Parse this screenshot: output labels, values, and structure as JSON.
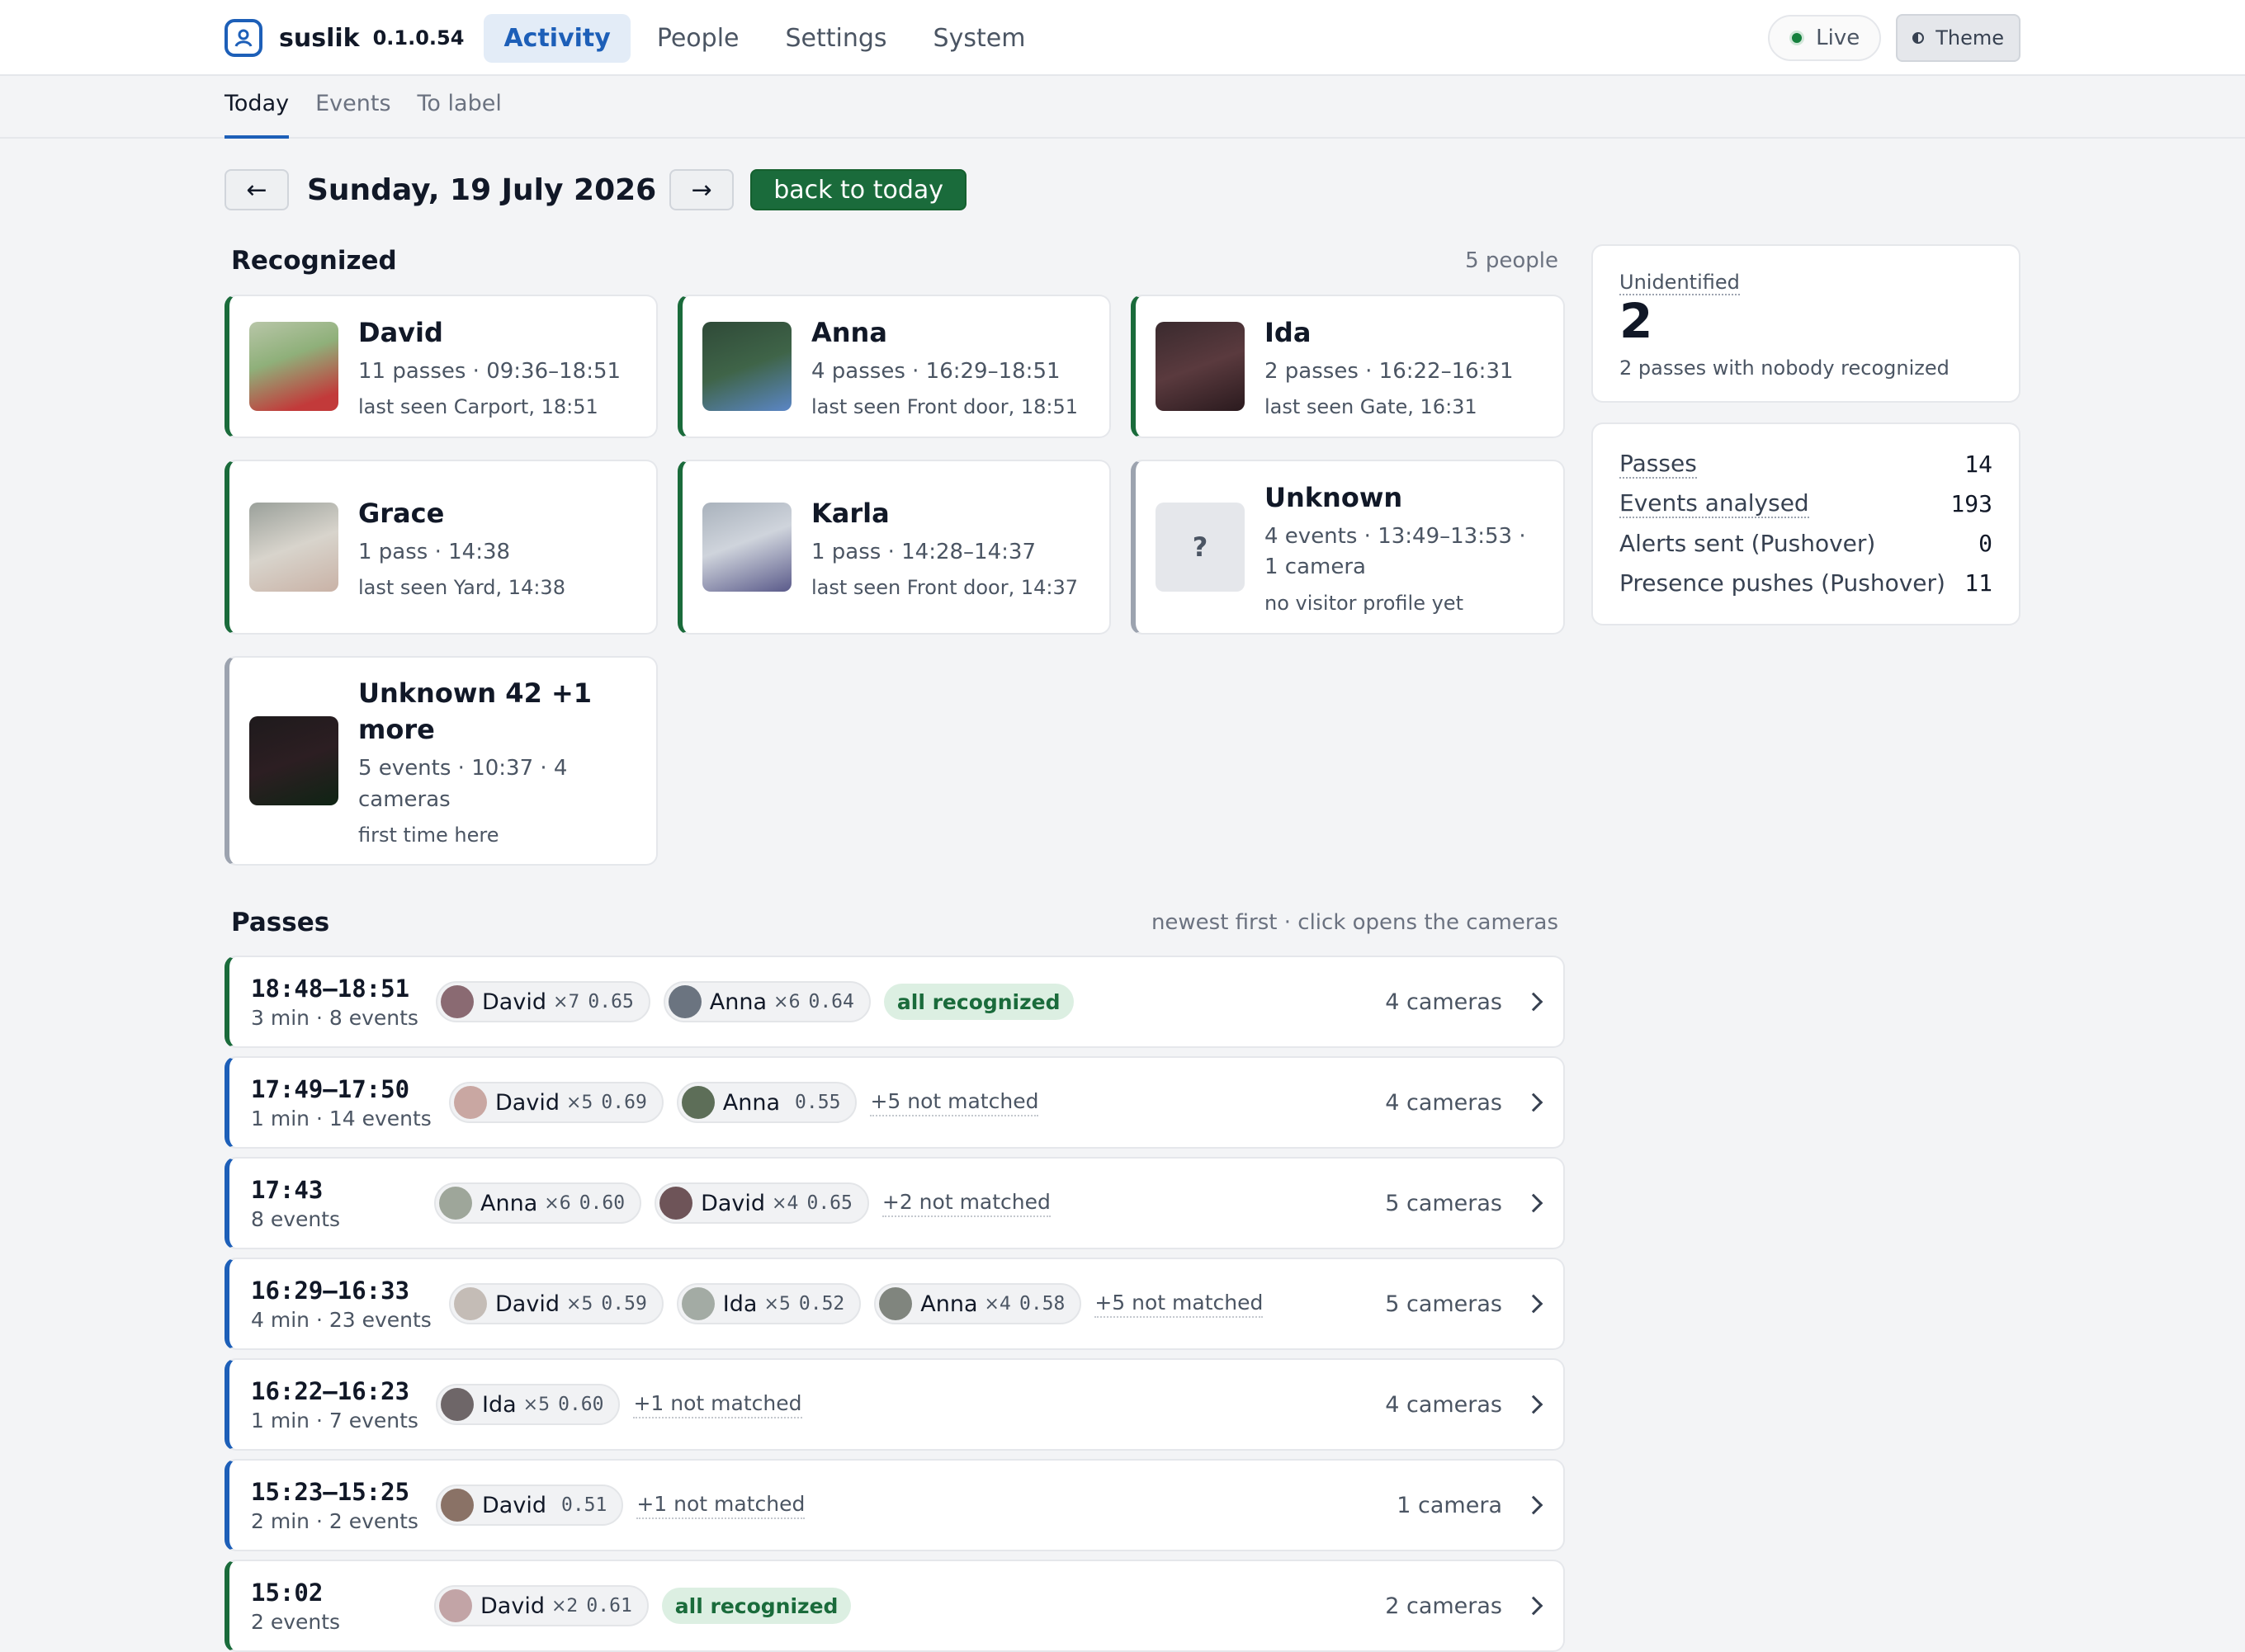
{
  "header": {
    "app_name": "suslik",
    "version": "0.1.0.54",
    "nav": [
      "Activity",
      "People",
      "Settings",
      "System"
    ],
    "live_label": "Live",
    "theme_label": "Theme"
  },
  "subtabs": [
    "Today",
    "Events",
    "To label"
  ],
  "date": {
    "prev": "←",
    "title": "Sunday, 19 July 2026",
    "next": "→",
    "today_button": "back to today"
  },
  "recognized": {
    "title": "Recognized",
    "count": "5 people",
    "people": [
      {
        "name": "David",
        "line1": "11 passes · 09:36–18:51",
        "line2": "last seen Carport, 18:51"
      },
      {
        "name": "Anna",
        "line1": "4 passes · 16:29–18:51",
        "line2": "last seen Front door, 18:51"
      },
      {
        "name": "Ida",
        "line1": "2 passes · 16:22–16:31",
        "line2": "last seen Gate, 16:31"
      },
      {
        "name": "Grace",
        "line1": "1 pass · 14:38",
        "line2": "last seen Yard, 14:38"
      },
      {
        "name": "Karla",
        "line1": "1 pass · 14:28–14:37",
        "line2": "last seen Front door, 14:37"
      },
      {
        "name": "Unknown",
        "line1": "4 events · 13:49–13:53 ·",
        "line1b": "1 camera",
        "line2": "no visitor profile yet",
        "avatar": "?"
      },
      {
        "name": "Unknown 42 +1",
        "name2": "more",
        "line1": "5 events · 10:37 · 4",
        "line1b": "cameras",
        "line2": "first time here"
      }
    ]
  },
  "sidebar": {
    "unidentified_label": "Unidentified",
    "unidentified_value": "2",
    "unidentified_sub": "2 passes with nobody recognized",
    "stats": [
      {
        "label": "Passes",
        "value": "14"
      },
      {
        "label": "Events analysed",
        "value": "193"
      },
      {
        "label": "Alerts sent (Pushover)",
        "value": "0"
      },
      {
        "label": "Presence pushes (Pushover)",
        "value": "11"
      }
    ]
  },
  "passes": {
    "title": "Passes",
    "meta": "newest first · click opens the cameras",
    "rows": [
      {
        "time": "18:48–18:51",
        "detail": "3 min · 8 events",
        "chips": [
          {
            "name": "David",
            "count": "×7",
            "score": "0.65"
          },
          {
            "name": "Anna",
            "count": "×6",
            "score": "0.64"
          }
        ],
        "status": "all recognized",
        "cameras": "4 cameras"
      },
      {
        "time": "17:49–17:50",
        "detail": "1 min · 14 events",
        "chips": [
          {
            "name": "David",
            "count": "×5",
            "score": "0.69"
          },
          {
            "name": "Anna",
            "count": "",
            "score": "0.55"
          }
        ],
        "unmatched": "+5 not matched",
        "cameras": "4 cameras"
      },
      {
        "time": "17:43",
        "detail": "8 events",
        "chips": [
          {
            "name": "Anna",
            "count": "×6",
            "score": "0.60"
          },
          {
            "name": "David",
            "count": "×4",
            "score": "0.65"
          }
        ],
        "unmatched": "+2 not matched",
        "cameras": "5 cameras"
      },
      {
        "time": "16:29–16:33",
        "detail": "4 min · 23 events",
        "chips": [
          {
            "name": "David",
            "count": "×5",
            "score": "0.59"
          },
          {
            "name": "Ida",
            "count": "×5",
            "score": "0.52"
          },
          {
            "name": "Anna",
            "count": "×4",
            "score": "0.58"
          }
        ],
        "unmatched": "+5 not matched",
        "cameras": "5 cameras"
      },
      {
        "time": "16:22–16:23",
        "detail": "1 min · 7 events",
        "chips": [
          {
            "name": "Ida",
            "count": "×5",
            "score": "0.60"
          }
        ],
        "unmatched": "+1 not matched",
        "cameras": "4 cameras"
      },
      {
        "time": "15:23–15:25",
        "detail": "2 min · 2 events",
        "chips": [
          {
            "name": "David",
            "count": "",
            "score": "0.51"
          }
        ],
        "unmatched": "+1 not matched",
        "cameras": "1 camera"
      },
      {
        "time": "15:02",
        "detail": "2 events",
        "chips": [
          {
            "name": "David",
            "count": "×2",
            "score": "0.61"
          }
        ],
        "status": "all recognized",
        "cameras": "2 cameras"
      }
    ]
  },
  "colors": {
    "accent": "#1d5fb8",
    "success": "#1a6b3b",
    "background": "#f3f4f6"
  }
}
